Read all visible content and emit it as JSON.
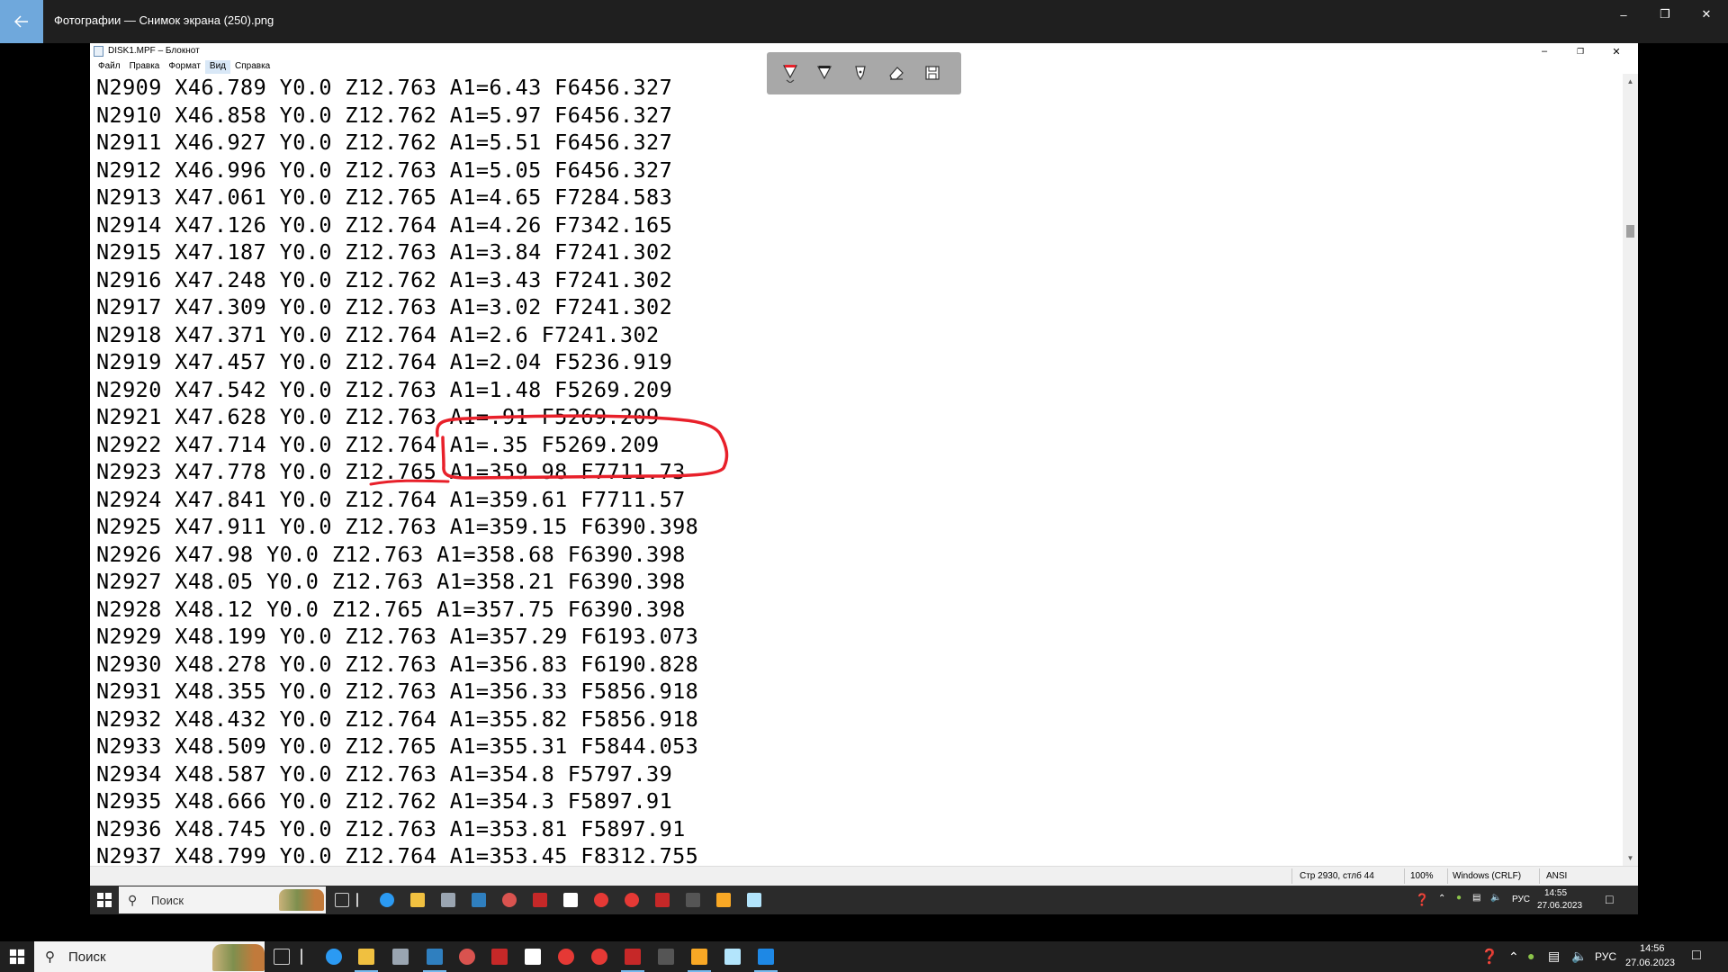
{
  "photos": {
    "title": "Фотографии — Снимок экрана (250).png",
    "back_icon": "arrow-left-icon"
  },
  "notepad": {
    "title": "DISK1.MPF – Блокнот",
    "menu": [
      "Файл",
      "Правка",
      "Формат",
      "Вид",
      "Справка"
    ],
    "active_menu": "Вид",
    "lines": [
      "N2909 X46.789 Y0.0 Z12.763 A1=6.43 F6456.327",
      "N2910 X46.858 Y0.0 Z12.762 A1=5.97 F6456.327",
      "N2911 X46.927 Y0.0 Z12.762 A1=5.51 F6456.327",
      "N2912 X46.996 Y0.0 Z12.763 A1=5.05 F6456.327",
      "N2913 X47.061 Y0.0 Z12.765 A1=4.65 F7284.583",
      "N2914 X47.126 Y0.0 Z12.764 A1=4.26 F7342.165",
      "N2915 X47.187 Y0.0 Z12.763 A1=3.84 F7241.302",
      "N2916 X47.248 Y0.0 Z12.762 A1=3.43 F7241.302",
      "N2917 X47.309 Y0.0 Z12.763 A1=3.02 F7241.302",
      "N2918 X47.371 Y0.0 Z12.764 A1=2.6 F7241.302",
      "N2919 X47.457 Y0.0 Z12.764 A1=2.04 F5236.919",
      "N2920 X47.542 Y0.0 Z12.763 A1=1.48 F5269.209",
      "N2921 X47.628 Y0.0 Z12.763 A1=.91 F5269.209",
      "N2922 X47.714 Y0.0 Z12.764 A1=.35 F5269.209",
      "N2923 X47.778 Y0.0 Z12.765 A1=359.98 F7711.73",
      "N2924 X47.841 Y0.0 Z12.764 A1=359.61 F7711.57",
      "N2925 X47.911 Y0.0 Z12.763 A1=359.15 F6390.398",
      "N2926 X47.98 Y0.0 Z12.763 A1=358.68 F6390.398",
      "N2927 X48.05 Y0.0 Z12.763 A1=358.21 F6390.398",
      "N2928 X48.12 Y0.0 Z12.765 A1=357.75 F6390.398",
      "N2929 X48.199 Y0.0 Z12.763 A1=357.29 F6193.073",
      "N2930 X48.278 Y0.0 Z12.763 A1=356.83 F6190.828",
      "N2931 X48.355 Y0.0 Z12.763 A1=356.33 F5856.918",
      "N2932 X48.432 Y0.0 Z12.764 A1=355.82 F5856.918",
      "N2933 X48.509 Y0.0 Z12.765 A1=355.31 F5844.053",
      "N2934 X48.587 Y0.0 Z12.763 A1=354.8 F5797.39",
      "N2935 X48.666 Y0.0 Z12.762 A1=354.3 F5897.91",
      "N2936 X48.745 Y0.0 Z12.763 A1=353.81 F5897.91",
      "N2937 X48.799 Y0.0 Z12.764 A1=353.45 F8312.755"
    ],
    "status": {
      "position": "Стр 2930, стлб 44",
      "zoom": "100%",
      "line_ending": "Windows (CRLF)",
      "encoding": "ANSI"
    }
  },
  "annotation": {
    "color": "#e8202a"
  },
  "markup_tools": [
    "ballpoint-pen-icon",
    "pencil-icon",
    "calligraphy-pen-icon",
    "eraser-icon",
    "save-icon"
  ],
  "inner_taskbar": {
    "search_placeholder": "Поиск",
    "lang": "РУС",
    "time": "14:55",
    "date": "27.06.2023"
  },
  "taskbar": {
    "search_placeholder": "Поиск",
    "lang": "РУС",
    "time": "14:56",
    "date": "27.06.2023"
  }
}
